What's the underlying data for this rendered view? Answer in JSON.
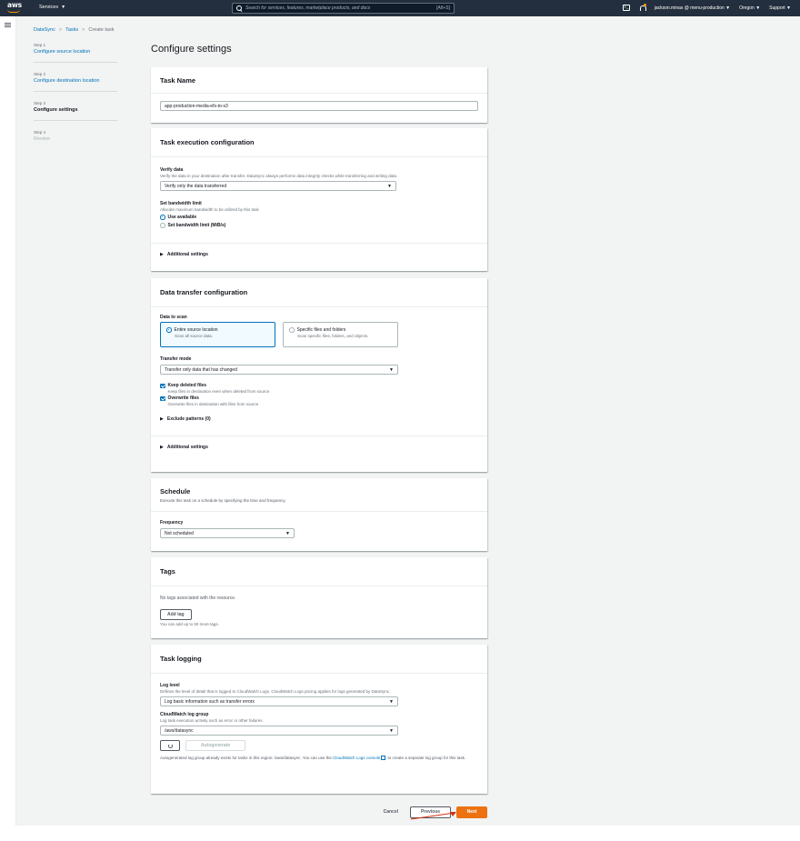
{
  "nav": {
    "logo": "aws",
    "services": "Services",
    "search_placeholder": "Search for services, features, marketplace products, and docs",
    "search_shortcut": "[Alt+S]",
    "account": "jackson.minas @ menu-production",
    "region": "Oregon",
    "support": "Support"
  },
  "breadcrumb": {
    "items": [
      "DataSync",
      "Tasks"
    ],
    "current": "Create task"
  },
  "steps": [
    {
      "num": "Step 1",
      "label": "Configure source location"
    },
    {
      "num": "Step 2",
      "label": "Configure destination location"
    },
    {
      "num": "Step 3",
      "label": "Configure settings"
    },
    {
      "num": "Step 4",
      "label": "Review"
    }
  ],
  "page_title": "Configure settings",
  "task_name": {
    "title": "Task Name",
    "value": "app-production-media-efs-to-s3"
  },
  "execution": {
    "title": "Task execution configuration",
    "verify_label": "Verify data",
    "verify_desc": "Verify the data in your destination after transfer. DataSync always performs data integrity checks while transferring and writing data.",
    "verify_value": "Verify only the data transferred",
    "bandwidth_label": "Set bandwidth limit",
    "bandwidth_desc": "Allocate maximum bandwidth to be utilized by this task",
    "opt_use_available": "Use available",
    "opt_set_limit": "Set bandwidth limit (MiB/s)",
    "additional": "Additional settings"
  },
  "transfer": {
    "title": "Data transfer configuration",
    "scan_label": "Data to scan",
    "tile1_title": "Entire source location",
    "tile1_desc": "Scan all source data.",
    "tile2_title": "Specific files and folders",
    "tile2_desc": "Scan specific files, folders, and objects.",
    "mode_label": "Transfer mode",
    "mode_value": "Transfer only data that has changed",
    "keep_label": "Keep deleted files",
    "keep_desc": "Keep files in destination even when deleted from source",
    "overwrite_label": "Overwrite files",
    "overwrite_desc": "Overwrite files in destination with files from source",
    "exclude": "Exclude patterns (0)",
    "additional": "Additional settings"
  },
  "schedule": {
    "title": "Schedule",
    "desc": "Execute this task on a schedule by specifying the time and frequency.",
    "freq_label": "Frequency",
    "freq_value": "Not scheduled"
  },
  "tags": {
    "title": "Tags",
    "empty": "No tags associated with the resource.",
    "add": "Add tag",
    "hint": "You can add up to 50 more tags."
  },
  "logging": {
    "title": "Task logging",
    "level_label": "Log level",
    "level_desc": "Defines the level of detail that is logged to CloudWatch Logs. CloudWatch Logs pricing applies for logs generated by DataSync.",
    "level_value": "Log basic information such as transfer errors",
    "group_label": "CloudWatch log group",
    "group_desc": "Log task execution activity such as error or other failures.",
    "group_value": "/aws/datasync",
    "autogenerate": "Autogenerate",
    "note_pre": "Autogenerated log group already exists for tasks in this region: /aws/datasync. You can use the",
    "note_link": "CloudWatch Logs console",
    "note_post": "to create a separate log group for this task."
  },
  "footer": {
    "cancel": "Cancel",
    "previous": "Previous",
    "next": "Next"
  },
  "colors": {
    "nav_bg": "#232f3e",
    "link": "#0073bb",
    "primary": "#ec7211",
    "annotation": "#d13212"
  }
}
